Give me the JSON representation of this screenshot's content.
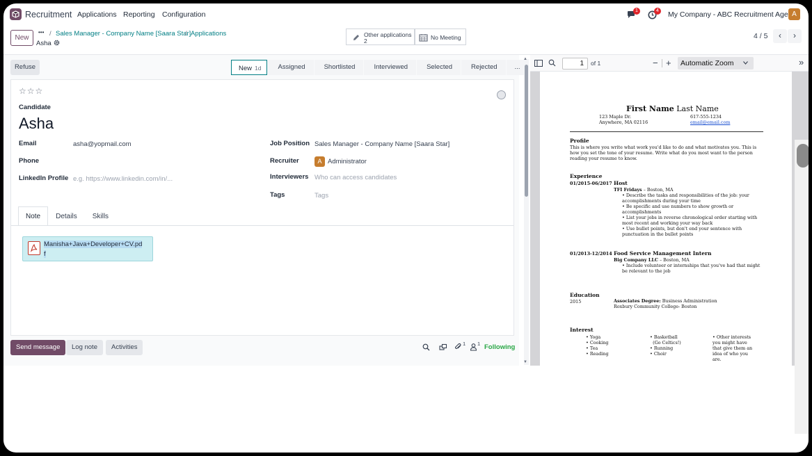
{
  "nav": {
    "app_name": "Recruitment",
    "menu": [
      "Applications",
      "Reporting",
      "Configuration"
    ],
    "chat_badge": "1",
    "activity_badge": "4",
    "company": "My Company - ABC Recruitment Age...",
    "user_initial": "A"
  },
  "control": {
    "new_label": "New",
    "more": "•••",
    "sep": "/",
    "breadcrumb_1": "Sales Manager - Company Name [Saara Star]",
    "breadcrumb_2": "Applications",
    "record": "Asha",
    "smart_other_label": "Other applications",
    "smart_other_count": "2",
    "smart_meeting": "No Meeting",
    "pager": "4 / 5",
    "prev": "‹",
    "next": "›"
  },
  "statusbar": {
    "refuse": "Refuse",
    "stages": [
      {
        "label": "New",
        "days": "1d"
      },
      {
        "label": "Assigned"
      },
      {
        "label": "Shortlisted"
      },
      {
        "label": "Interviewed"
      },
      {
        "label": "Selected"
      },
      {
        "label": "Rejected"
      },
      {
        "label": "..."
      }
    ]
  },
  "form": {
    "stars": "☆☆☆",
    "candidate_label": "Candidate",
    "candidate_name": "Asha",
    "email_label": "Email",
    "email": "asha@yopmail.com",
    "phone_label": "Phone",
    "linkedin_label": "LinkedIn Profile",
    "linkedin_placeholder": "e.g. https://www.linkedin.com/in/...",
    "job_label": "Job Position",
    "job": "Sales Manager - Company Name [Saara Star]",
    "recruiter_label": "Recruiter",
    "recruiter_initial": "A",
    "recruiter": "Administrator",
    "interviewers_label": "Interviewers",
    "interviewers_placeholder": "Who can access candidates",
    "tags_label": "Tags",
    "tags_placeholder": "Tags"
  },
  "tabs": [
    "Note",
    "Details",
    "Skills"
  ],
  "attachment": {
    "filename_1": "Manisha+Java+Developer+CV.pd",
    "filename_2": "f"
  },
  "chatter": {
    "send": "Send message",
    "log": "Log note",
    "activities": "Activities",
    "attach_count": "1",
    "follower_count": "1",
    "following": "Following"
  },
  "pdf": {
    "page": "1",
    "of": "of 1",
    "minus": "−",
    "plus": "+",
    "zoom": "Automatic Zoom",
    "more": "»"
  },
  "resume": {
    "first": "First Name",
    "last": " Last Name",
    "addr1": "123 Maple Dr.",
    "addr2": "Anywhere, MA 02116",
    "phone": "617-555-1234",
    "email": "email@email.com",
    "profile_h": "Profile",
    "profile": "This is where you write what work you'd like to do and what motivates you. This is how you set the tone of your resume. Write what do you most want to the person reading your resume to know.",
    "exp_h": "Experience",
    "job1_dates": "01/2015-06/2017",
    "job1_title": "Host",
    "job1_co": "TFI Fridays",
    "job1_loc": " – Boston, MA",
    "job1_b": [
      "Describe the tasks and responsibilities of the job: your accomplishments during your time",
      "Be specific and use numbers to show growth or accomplishments",
      "List your jobs in reverse chronological order starting with most recent and working your way back",
      "Use bullet points, but don't end your sentence with punctuation in the bullet points"
    ],
    "job2_dates": "01/2013-12/2014",
    "job2_title": "Food Service Management Intern",
    "job2_co": "Big Company LLC",
    "job2_loc": " – Boston, MA",
    "job2_b": "Include volunteer or internships that you've had that might be relevant to the job",
    "edu_h": "Education",
    "edu_year": "2015",
    "edu_deg": "Associates Degree:",
    "edu_field": " Business Administration",
    "edu_school": "Roxbury Community College- Boston",
    "int_h": "Interest",
    "col1": [
      "Yoga",
      "Cooking",
      "Tea",
      "Reading"
    ],
    "col2": [
      "Basketball",
      "(Go Celtics!)",
      "Running",
      "Choir"
    ],
    "col3": "Other interests you might have that give them an idea of who you are."
  },
  "colors": {
    "brand": "#714b67",
    "teal": "#017e84",
    "following": "#28a745"
  }
}
